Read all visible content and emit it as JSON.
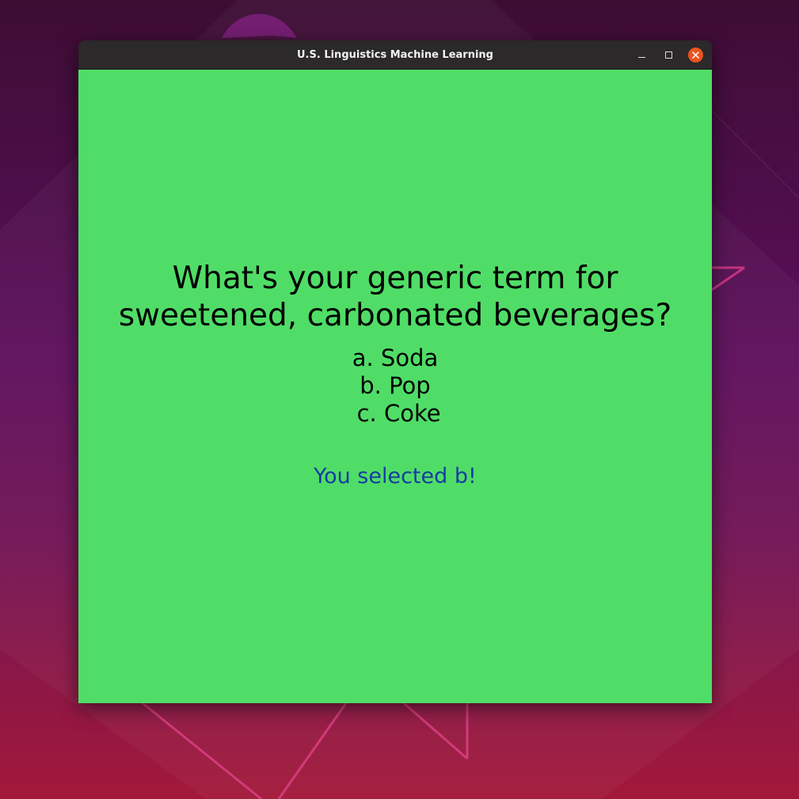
{
  "window": {
    "title": "U.S. Linguistics Machine Learning",
    "background_color": "#50dd67",
    "controls": {
      "minimize_icon": "minimize-icon",
      "maximize_icon": "maximize-icon",
      "close_icon": "close-icon",
      "close_color": "#e95420"
    }
  },
  "quiz": {
    "question_lines": [
      "What's your generic term for",
      "sweetened, carbonated beverages?"
    ],
    "options": [
      "a. Soda",
      "b. Pop",
      " c. Coke"
    ],
    "selection_message": "You selected b!",
    "selection_color": "#143ca3"
  }
}
